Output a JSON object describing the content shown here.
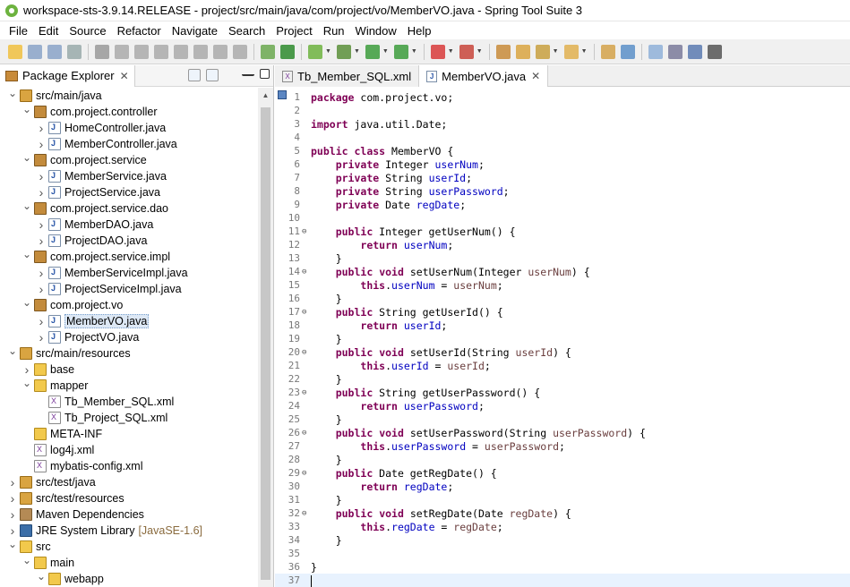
{
  "window": {
    "title": "workspace-sts-3.9.14.RELEASE - project/src/main/java/com/project/vo/MemberVO.java - Spring Tool Suite 3"
  },
  "menu": [
    "File",
    "Edit",
    "Source",
    "Refactor",
    "Navigate",
    "Search",
    "Project",
    "Run",
    "Window",
    "Help"
  ],
  "toolbar": {
    "icons": [
      "new-icon",
      "save-icon",
      "save-all-icon",
      "print-icon",
      "debug-skip-icon",
      "resume-icon",
      "suspend-icon",
      "terminate-icon",
      "disconnect-icon",
      "step-into-icon",
      "step-over-icon",
      "step-return-icon",
      "boot-dashboard-icon",
      "power-icon",
      "spring-icon",
      "debug-icon",
      "run-icon",
      "external-tools-icon",
      "stop-icon",
      "server-icon",
      "new-package-icon",
      "new-class-icon",
      "open-type-icon",
      "open-task-icon",
      "search-icon",
      "annotation-icon",
      "highlight-icon",
      "toggle-breadcrumb-icon",
      "word-wrap-icon",
      "pilcrow-icon"
    ]
  },
  "package_explorer": {
    "title": "Package Explorer",
    "tree": [
      {
        "label": "src/main/java",
        "indent": 1,
        "icon": "srcfolder",
        "arrow": "down"
      },
      {
        "label": "com.project.controller",
        "indent": 2,
        "icon": "pkg",
        "arrow": "down"
      },
      {
        "label": "HomeController.java",
        "indent": 3,
        "icon": "java",
        "arrow": "right"
      },
      {
        "label": "MemberController.java",
        "indent": 3,
        "icon": "java",
        "arrow": "right"
      },
      {
        "label": "com.project.service",
        "indent": 2,
        "icon": "pkg",
        "arrow": "down"
      },
      {
        "label": "MemberService.java",
        "indent": 3,
        "icon": "java",
        "arrow": "right"
      },
      {
        "label": "ProjectService.java",
        "indent": 3,
        "icon": "java",
        "arrow": "right"
      },
      {
        "label": "com.project.service.dao",
        "indent": 2,
        "icon": "pkg",
        "arrow": "down"
      },
      {
        "label": "MemberDAO.java",
        "indent": 3,
        "icon": "java",
        "arrow": "right"
      },
      {
        "label": "ProjectDAO.java",
        "indent": 3,
        "icon": "java",
        "arrow": "right"
      },
      {
        "label": "com.project.service.impl",
        "indent": 2,
        "icon": "pkg",
        "arrow": "down"
      },
      {
        "label": "MemberServiceImpl.java",
        "indent": 3,
        "icon": "java",
        "arrow": "right"
      },
      {
        "label": "ProjectServiceImpl.java",
        "indent": 3,
        "icon": "java",
        "arrow": "right"
      },
      {
        "label": "com.project.vo",
        "indent": 2,
        "icon": "pkg",
        "arrow": "down"
      },
      {
        "label": "MemberVO.java",
        "indent": 3,
        "icon": "java",
        "arrow": "right",
        "selected": true
      },
      {
        "label": "ProjectVO.java",
        "indent": 3,
        "icon": "java",
        "arrow": "right"
      },
      {
        "label": "src/main/resources",
        "indent": 1,
        "icon": "srcfolder",
        "arrow": "down"
      },
      {
        "label": "base",
        "indent": 2,
        "icon": "folder",
        "arrow": "right"
      },
      {
        "label": "mapper",
        "indent": 2,
        "icon": "folder",
        "arrow": "down"
      },
      {
        "label": "Tb_Member_SQL.xml",
        "indent": 3,
        "icon": "xml",
        "arrow": ""
      },
      {
        "label": "Tb_Project_SQL.xml",
        "indent": 3,
        "icon": "xml",
        "arrow": ""
      },
      {
        "label": "META-INF",
        "indent": 2,
        "icon": "folder",
        "arrow": ""
      },
      {
        "label": "log4j.xml",
        "indent": 2,
        "icon": "xml",
        "arrow": ""
      },
      {
        "label": "mybatis-config.xml",
        "indent": 2,
        "icon": "xml",
        "arrow": ""
      },
      {
        "label": "src/test/java",
        "indent": 1,
        "icon": "srcfolder",
        "arrow": "right"
      },
      {
        "label": "src/test/resources",
        "indent": 1,
        "icon": "srcfolder",
        "arrow": "right"
      },
      {
        "label": "Maven Dependencies",
        "indent": 1,
        "icon": "lib",
        "arrow": "right"
      },
      {
        "label": "JRE System Library",
        "indent": 1,
        "icon": "jre",
        "arrow": "right",
        "suffix": "[JavaSE-1.6]"
      },
      {
        "label": "src",
        "indent": 1,
        "icon": "folder",
        "arrow": "down"
      },
      {
        "label": "main",
        "indent": 2,
        "icon": "folder",
        "arrow": "down"
      },
      {
        "label": "webapp",
        "indent": 3,
        "icon": "folder",
        "arrow": "down"
      }
    ]
  },
  "editor": {
    "tabs": [
      {
        "label": "Tb_Member_SQL.xml",
        "type": "xml",
        "active": false
      },
      {
        "label": "MemberVO.java",
        "type": "java",
        "active": true
      }
    ],
    "lines": [
      {
        "n": "1",
        "fold": "",
        "segs": [
          [
            "kw",
            "package"
          ],
          [
            "t",
            " com.project.vo;"
          ]
        ]
      },
      {
        "n": "2",
        "fold": "",
        "segs": []
      },
      {
        "n": "3",
        "fold": "",
        "segs": [
          [
            "kw",
            "import"
          ],
          [
            "t",
            " java.util.Date;"
          ]
        ]
      },
      {
        "n": "4",
        "fold": "",
        "segs": []
      },
      {
        "n": "5",
        "fold": "",
        "segs": [
          [
            "kw",
            "public"
          ],
          [
            "t",
            " "
          ],
          [
            "kw",
            "class"
          ],
          [
            "t",
            " MemberVO {"
          ]
        ]
      },
      {
        "n": "6",
        "fold": "",
        "segs": [
          [
            "t",
            "    "
          ],
          [
            "kw",
            "private"
          ],
          [
            "t",
            " Integer "
          ],
          [
            "fld",
            "userNum"
          ],
          [
            "t",
            ";"
          ]
        ]
      },
      {
        "n": "7",
        "fold": "",
        "segs": [
          [
            "t",
            "    "
          ],
          [
            "kw",
            "private"
          ],
          [
            "t",
            " String "
          ],
          [
            "fld",
            "userId"
          ],
          [
            "t",
            ";"
          ]
        ]
      },
      {
        "n": "8",
        "fold": "",
        "segs": [
          [
            "t",
            "    "
          ],
          [
            "kw",
            "private"
          ],
          [
            "t",
            " String "
          ],
          [
            "fld",
            "userPassword"
          ],
          [
            "t",
            ";"
          ]
        ]
      },
      {
        "n": "9",
        "fold": "",
        "segs": [
          [
            "t",
            "    "
          ],
          [
            "kw",
            "private"
          ],
          [
            "t",
            " Date "
          ],
          [
            "fld",
            "regDate"
          ],
          [
            "t",
            ";"
          ]
        ]
      },
      {
        "n": "10",
        "fold": "",
        "segs": []
      },
      {
        "n": "11",
        "fold": "⊖",
        "segs": [
          [
            "t",
            "    "
          ],
          [
            "kw",
            "public"
          ],
          [
            "t",
            " Integer getUserNum() {"
          ]
        ]
      },
      {
        "n": "12",
        "fold": "",
        "segs": [
          [
            "t",
            "        "
          ],
          [
            "kw",
            "return"
          ],
          [
            "t",
            " "
          ],
          [
            "fld",
            "userNum"
          ],
          [
            "t",
            ";"
          ]
        ]
      },
      {
        "n": "13",
        "fold": "",
        "segs": [
          [
            "t",
            "    }"
          ]
        ]
      },
      {
        "n": "14",
        "fold": "⊖",
        "segs": [
          [
            "t",
            "    "
          ],
          [
            "kw",
            "public"
          ],
          [
            "t",
            " "
          ],
          [
            "kw",
            "void"
          ],
          [
            "t",
            " setUserNum(Integer "
          ],
          [
            "prm",
            "userNum"
          ],
          [
            "t",
            ") {"
          ]
        ]
      },
      {
        "n": "15",
        "fold": "",
        "segs": [
          [
            "t",
            "        "
          ],
          [
            "kw",
            "this"
          ],
          [
            "t",
            "."
          ],
          [
            "fld",
            "userNum"
          ],
          [
            "t",
            " = "
          ],
          [
            "prm",
            "userNum"
          ],
          [
            "t",
            ";"
          ]
        ]
      },
      {
        "n": "16",
        "fold": "",
        "segs": [
          [
            "t",
            "    }"
          ]
        ]
      },
      {
        "n": "17",
        "fold": "⊖",
        "segs": [
          [
            "t",
            "    "
          ],
          [
            "kw",
            "public"
          ],
          [
            "t",
            " String getUserId() {"
          ]
        ]
      },
      {
        "n": "18",
        "fold": "",
        "segs": [
          [
            "t",
            "        "
          ],
          [
            "kw",
            "return"
          ],
          [
            "t",
            " "
          ],
          [
            "fld",
            "userId"
          ],
          [
            "t",
            ";"
          ]
        ]
      },
      {
        "n": "19",
        "fold": "",
        "segs": [
          [
            "t",
            "    }"
          ]
        ]
      },
      {
        "n": "20",
        "fold": "⊖",
        "segs": [
          [
            "t",
            "    "
          ],
          [
            "kw",
            "public"
          ],
          [
            "t",
            " "
          ],
          [
            "kw",
            "void"
          ],
          [
            "t",
            " setUserId(String "
          ],
          [
            "prm",
            "userId"
          ],
          [
            "t",
            ") {"
          ]
        ]
      },
      {
        "n": "21",
        "fold": "",
        "segs": [
          [
            "t",
            "        "
          ],
          [
            "kw",
            "this"
          ],
          [
            "t",
            "."
          ],
          [
            "fld",
            "userId"
          ],
          [
            "t",
            " = "
          ],
          [
            "prm",
            "userId"
          ],
          [
            "t",
            ";"
          ]
        ]
      },
      {
        "n": "22",
        "fold": "",
        "segs": [
          [
            "t",
            "    }"
          ]
        ]
      },
      {
        "n": "23",
        "fold": "⊖",
        "segs": [
          [
            "t",
            "    "
          ],
          [
            "kw",
            "public"
          ],
          [
            "t",
            " String getUserPassword() {"
          ]
        ]
      },
      {
        "n": "24",
        "fold": "",
        "segs": [
          [
            "t",
            "        "
          ],
          [
            "kw",
            "return"
          ],
          [
            "t",
            " "
          ],
          [
            "fld",
            "userPassword"
          ],
          [
            "t",
            ";"
          ]
        ]
      },
      {
        "n": "25",
        "fold": "",
        "segs": [
          [
            "t",
            "    }"
          ]
        ]
      },
      {
        "n": "26",
        "fold": "⊖",
        "segs": [
          [
            "t",
            "    "
          ],
          [
            "kw",
            "public"
          ],
          [
            "t",
            " "
          ],
          [
            "kw",
            "void"
          ],
          [
            "t",
            " setUserPassword(String "
          ],
          [
            "prm",
            "userPassword"
          ],
          [
            "t",
            ") {"
          ]
        ]
      },
      {
        "n": "27",
        "fold": "",
        "segs": [
          [
            "t",
            "        "
          ],
          [
            "kw",
            "this"
          ],
          [
            "t",
            "."
          ],
          [
            "fld",
            "userPassword"
          ],
          [
            "t",
            " = "
          ],
          [
            "prm",
            "userPassword"
          ],
          [
            "t",
            ";"
          ]
        ]
      },
      {
        "n": "28",
        "fold": "",
        "segs": [
          [
            "t",
            "    }"
          ]
        ]
      },
      {
        "n": "29",
        "fold": "⊖",
        "segs": [
          [
            "t",
            "    "
          ],
          [
            "kw",
            "public"
          ],
          [
            "t",
            " Date getRegDate() {"
          ]
        ]
      },
      {
        "n": "30",
        "fold": "",
        "segs": [
          [
            "t",
            "        "
          ],
          [
            "kw",
            "return"
          ],
          [
            "t",
            " "
          ],
          [
            "fld",
            "regDate"
          ],
          [
            "t",
            ";"
          ]
        ]
      },
      {
        "n": "31",
        "fold": "",
        "segs": [
          [
            "t",
            "    }"
          ]
        ]
      },
      {
        "n": "32",
        "fold": "⊖",
        "segs": [
          [
            "t",
            "    "
          ],
          [
            "kw",
            "public"
          ],
          [
            "t",
            " "
          ],
          [
            "kw",
            "void"
          ],
          [
            "t",
            " setRegDate(Date "
          ],
          [
            "prm",
            "regDate"
          ],
          [
            "t",
            ") {"
          ]
        ]
      },
      {
        "n": "33",
        "fold": "",
        "segs": [
          [
            "t",
            "        "
          ],
          [
            "kw",
            "this"
          ],
          [
            "t",
            "."
          ],
          [
            "fld",
            "regDate"
          ],
          [
            "t",
            " = "
          ],
          [
            "prm",
            "regDate"
          ],
          [
            "t",
            ";"
          ]
        ]
      },
      {
        "n": "34",
        "fold": "",
        "segs": [
          [
            "t",
            "    }"
          ]
        ]
      },
      {
        "n": "35",
        "fold": "",
        "segs": []
      },
      {
        "n": "36",
        "fold": "",
        "segs": [
          [
            "t",
            "}"
          ]
        ]
      },
      {
        "n": "37",
        "fold": "",
        "segs": [],
        "current": true
      }
    ]
  },
  "colors": {
    "keyword": "#7f0055",
    "field": "#0000c0",
    "param": "#6a3e3e",
    "current_line": "#e8f2fe",
    "selection": "#dde8f5"
  }
}
